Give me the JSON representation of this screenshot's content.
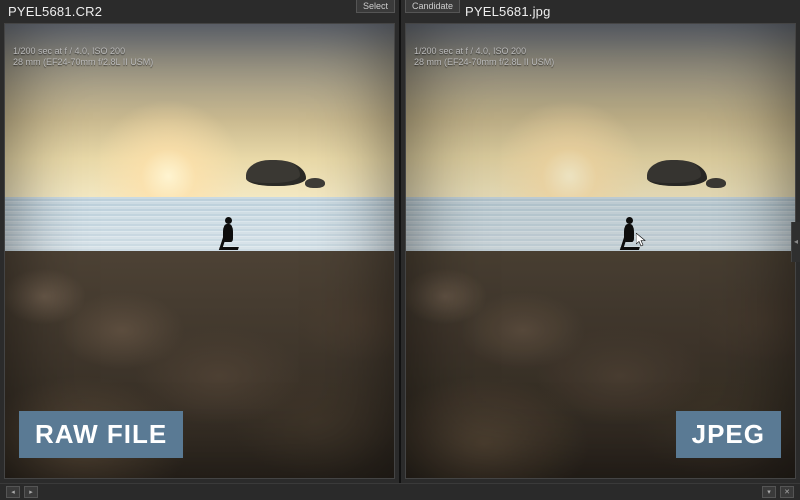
{
  "left_panel": {
    "tag": "Select",
    "filename": "PYEL5681.CR2",
    "exposure_line": "1/200 sec at f / 4.0, ISO 200",
    "lens_line": "28 mm (EF24-70mm f/2.8L II USM)",
    "overlay_label": "RAW FILE"
  },
  "right_panel": {
    "tag": "Candidate",
    "filename": "PYEL5681.jpg",
    "exposure_line": "1/200 sec at f / 4.0, ISO 200",
    "lens_line": "28 mm (EF24-70mm f/2.8L II USM)",
    "overlay_label": "JPEG"
  },
  "colors": {
    "overlay_bg": "#5a7a94",
    "panel_bg": "#2b2b2b"
  }
}
